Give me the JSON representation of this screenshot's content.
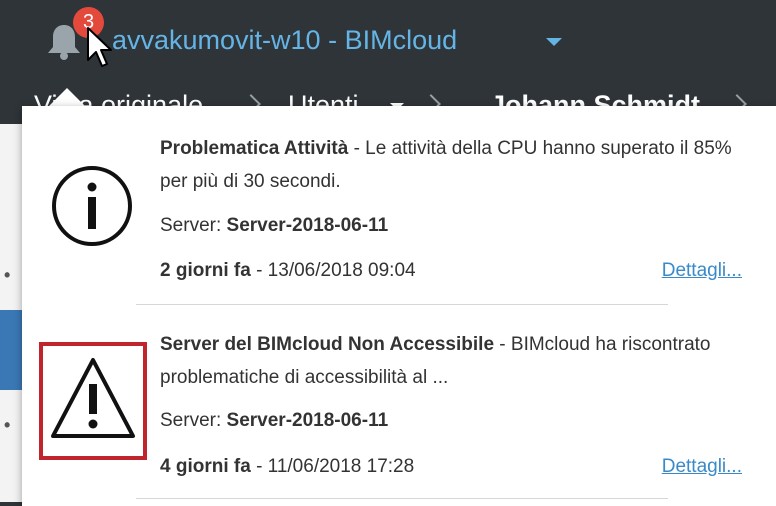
{
  "header": {
    "app_title": "avvakumovit-w10 - BIMcloud",
    "notification_count": "3"
  },
  "breadcrumb": {
    "items": [
      {
        "label": "Vista originale"
      },
      {
        "label": "Utenti"
      },
      {
        "label": "Johann Schmidt"
      }
    ]
  },
  "notifications": [
    {
      "icon": "info-icon",
      "title": "Problematica Attività",
      "message": " - Le attività della CPU hanno superato il 85% per più di 30 secondi.",
      "server_label": "Server: ",
      "server_value": "Server-2018-06-11",
      "age": "2 giorni fa",
      "timestamp": " - 13/06/2018 09:04",
      "details_label": "Dettagli..."
    },
    {
      "icon": "warning-icon",
      "title": "Server del BIMcloud Non Accessibile",
      "message": " - BIMcloud ha riscontrato problematiche di accessibilità al ...",
      "server_label": "Server: ",
      "server_value": "Server-2018-06-11",
      "age": "4 giorni fa",
      "timestamp": " - 11/06/2018 17:28",
      "details_label": "Dettagli..."
    }
  ],
  "colors": {
    "header_bg": "#2f3438",
    "link": "#3a8ac9",
    "title_blue": "#64b5e6",
    "badge": "#e44a3c",
    "highlight": "#c0242c"
  }
}
